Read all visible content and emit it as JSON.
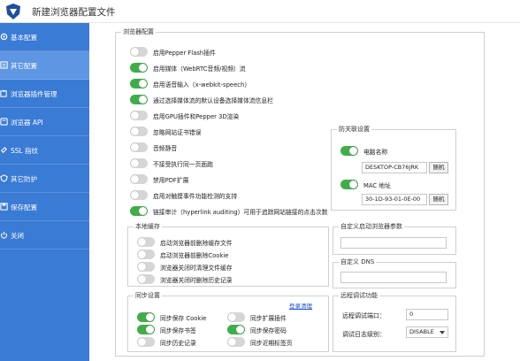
{
  "window": {
    "title": "新建浏览器配置文件"
  },
  "sidebar": {
    "items": [
      {
        "label": "基本配置",
        "icon": "gear-icon",
        "active": false
      },
      {
        "label": "其它配置",
        "icon": "sliders-icon",
        "active": true
      },
      {
        "label": "浏览器插件管理",
        "icon": "puzzle-icon",
        "active": false
      },
      {
        "label": "浏览器 API",
        "icon": "api-icon",
        "active": false
      },
      {
        "label": "SSL 指纹",
        "icon": "link-icon",
        "active": false
      },
      {
        "label": "其它防护",
        "icon": "shield-icon",
        "active": false
      },
      {
        "label": "保存配置",
        "icon": "save-icon",
        "active": false
      },
      {
        "label": "关闭",
        "icon": "power-icon",
        "active": false
      }
    ]
  },
  "browser_config": {
    "title": "浏览器配置",
    "options": [
      {
        "label": "启用Pepper Flash插件",
        "on": false
      },
      {
        "label": "启用媒体（WebRTC音频/视频）流",
        "on": true
      },
      {
        "label": "启用语音输入（x-webkit-speech）",
        "on": true
      },
      {
        "label": "通过选择媒体流的默认设备选择媒体流信息栏",
        "on": true
      },
      {
        "label": "启用GPU插件和Pepper 3D渲染",
        "on": false
      },
      {
        "label": "忽略网站证书错误",
        "on": false
      },
      {
        "label": "音频静音",
        "on": false
      },
      {
        "label": "不接受执行同一页面跑",
        "on": false
      },
      {
        "label": "禁用PDF扩展",
        "on": false
      },
      {
        "label": "启用对触摸事件功能检测的支持",
        "on": false
      },
      {
        "label": "链接审计（hyperlink auditing）可用于追踪网站链接的点击次数",
        "on": true
      }
    ]
  },
  "anti_association": {
    "title": "防关联设置",
    "computer_name": {
      "label": "电脑名称",
      "on": true,
      "value": "DESKTOP-CB76JRK",
      "button": "随机"
    },
    "mac_address": {
      "label": "MAC 地址",
      "on": true,
      "value": "30-1D-93-01-0E-00",
      "button": "随机"
    }
  },
  "local_cache": {
    "title": "本地缓存",
    "options": [
      {
        "label": "启动浏览器前删除缓存文件",
        "on": false
      },
      {
        "label": "启动浏览器前删除Cookie",
        "on": false
      },
      {
        "label": "浏览器关闭时清理文件缓存",
        "on": false
      },
      {
        "label": "浏览器关闭时删除历史记录",
        "on": false
      }
    ]
  },
  "startup_params": {
    "title": "自定义启动浏览器参数",
    "value": ""
  },
  "custom_dns": {
    "title": "自定义 DNS",
    "value": ""
  },
  "sync": {
    "title": "同步设置",
    "clear_link": "登录清理",
    "options": [
      {
        "label": "同步保存 Cookie",
        "on": true
      },
      {
        "label": "同步扩展插件",
        "on": false
      },
      {
        "label": "同步保存书签",
        "on": true
      },
      {
        "label": "同步保存密码",
        "on": true
      },
      {
        "label": "同步历史记录",
        "on": false
      },
      {
        "label": "同步近期标签页",
        "on": false
      }
    ]
  },
  "remote_debug": {
    "title": "远程调试功能",
    "port_label": "远程调试端口：",
    "port_value": "0",
    "log_label": "调试日志级别：",
    "log_value": "DISABLE"
  },
  "colors": {
    "sidebar": "#3a7bd5",
    "sidebar_active": "#5e96e3",
    "toggle_on": "#3fae49",
    "toggle_off": "#d6d6d6"
  }
}
